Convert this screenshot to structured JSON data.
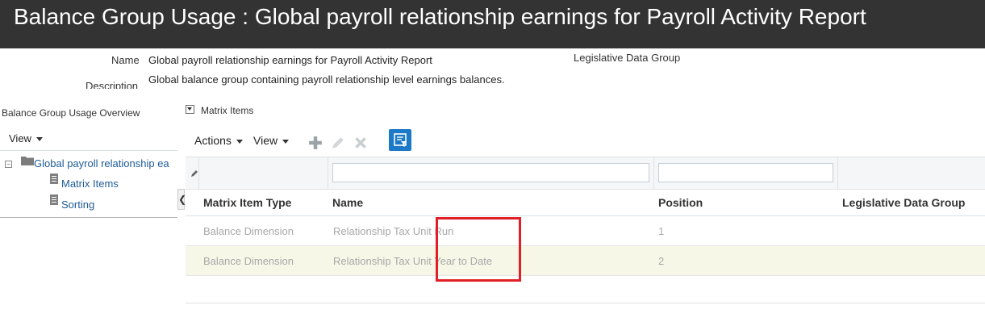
{
  "page": {
    "title": "Balance Group Usage : Global payroll relationship earnings for Payroll Activity Report"
  },
  "details": {
    "name_label": "Name",
    "name_value": "Global payroll relationship earnings for Payroll Activity Report",
    "description_label": "Description",
    "description_value": "Global balance group containing payroll relationship level earnings balances.",
    "ldg_label": "Legislative Data Group"
  },
  "overview": {
    "title": "Balance Group Usage Overview",
    "view_label": "View",
    "tree": {
      "root_label": "Global payroll relationship ea",
      "children": [
        {
          "label": "Matrix Items",
          "icon": "document-icon"
        },
        {
          "label": "Sorting",
          "icon": "document-icon"
        }
      ]
    }
  },
  "matrix": {
    "section_title": "Matrix Items",
    "toolbar": {
      "actions_label": "Actions",
      "view_label": "View",
      "icons": [
        "add-icon",
        "edit-icon",
        "delete-icon",
        "query-by-example-icon"
      ]
    },
    "columns": [
      "Matrix Item Type",
      "Name",
      "Position",
      "Legislative Data Group"
    ],
    "rows": [
      {
        "type": "Balance Dimension",
        "name": "Relationship Tax Unit Run",
        "position": "1",
        "ldg": ""
      },
      {
        "type": "Balance Dimension",
        "name": "Relationship Tax Unit Year to Date",
        "position": "2",
        "ldg": ""
      }
    ]
  },
  "colors": {
    "title_bar": "#333333",
    "link": "#1f5b96",
    "accent_button": "#1c79c7",
    "alt_row": "#f7f7e8",
    "highlight": "#e21f26"
  }
}
